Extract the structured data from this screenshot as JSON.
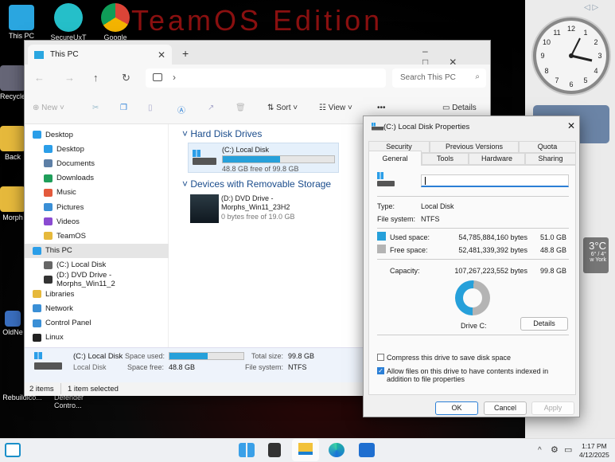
{
  "desktop": {
    "watermark": "TeamOS Edition",
    "icons": [
      "This PC",
      "SecureUxT",
      "Google",
      "Recycle",
      "Back",
      "Morph",
      "OldNe",
      "Rebuildico...",
      "Defender Contro..."
    ]
  },
  "gadgets": {
    "weather": {
      "temp": "3°C",
      "range": "6° / 4°",
      "city": "w York"
    }
  },
  "explorer": {
    "tab_title": "This PC",
    "search_placeholder": "Search This PC",
    "toolbar": {
      "new": "New",
      "sort": "Sort",
      "view": "View",
      "more": "•••",
      "details": "Details"
    },
    "sidebar": [
      {
        "label": "Desktop",
        "c": "#2b9ee8"
      },
      {
        "label": "Desktop",
        "c": "#2b9ee8"
      },
      {
        "label": "Documents",
        "c": "#5d7fa6"
      },
      {
        "label": "Downloads",
        "c": "#1f9e5a"
      },
      {
        "label": "Music",
        "c": "#e35a3c"
      },
      {
        "label": "Pictures",
        "c": "#3a8fd6"
      },
      {
        "label": "Videos",
        "c": "#8a4bd1"
      },
      {
        "label": "TeamOS",
        "c": "#e6b93c"
      },
      {
        "label": "This PC",
        "c": "#2b9ee8"
      },
      {
        "label": "(C:) Local Disk",
        "c": "#666"
      },
      {
        "label": "(D:) DVD Drive - Morphs_Win11_2",
        "c": "#333"
      },
      {
        "label": "Libraries",
        "c": "#e6b93c"
      },
      {
        "label": "Network",
        "c": "#3a8fd6"
      },
      {
        "label": "Control Panel",
        "c": "#3a8fd6"
      },
      {
        "label": "Linux",
        "c": "#222"
      }
    ],
    "groups": {
      "hdd": "Hard Disk Drives",
      "removable": "Devices with Removable Storage"
    },
    "drives": {
      "c": {
        "name": "(C:) Local Disk",
        "free": "48.8 GB free of 99.8 GB",
        "used_fraction": 0.511
      },
      "d": {
        "name": "(D:) DVD Drive -",
        "name2": "Morphs_Win11_23H2",
        "free": "0 bytes free of 19.0 GB"
      }
    },
    "details_pane": {
      "name": "(C:) Local Disk",
      "type": "Local Disk",
      "space_used_label": "Space used:",
      "space_free_label": "Space free:",
      "space_free": "48.8 GB",
      "total_label": "Total size:",
      "total": "99.8 GB",
      "fs_label": "File system:",
      "fs": "NTFS"
    },
    "status": {
      "items": "2 items",
      "selected": "1 item selected"
    }
  },
  "dialog": {
    "title": "(C:) Local Disk Properties",
    "tabs_top": [
      "Security",
      "Previous Versions",
      "Quota"
    ],
    "tabs_bottom": [
      "General",
      "Tools",
      "Hardware",
      "Sharing"
    ],
    "name_value": "",
    "type_label": "Type:",
    "type": "Local Disk",
    "fs_label": "File system:",
    "fs": "NTFS",
    "used_label": "Used space:",
    "used_bytes": "54,785,884,160 bytes",
    "used_gb": "51.0 GB",
    "free_label": "Free space:",
    "free_bytes": "52,481,339,392 bytes",
    "free_gb": "48.8 GB",
    "cap_label": "Capacity:",
    "cap_bytes": "107,267,223,552 bytes",
    "cap_gb": "99.8 GB",
    "used_fraction": 0.511,
    "drive_label": "Drive C:",
    "details_btn": "Details",
    "compress": "Compress this drive to save disk space",
    "compress_checked": false,
    "index": "Allow files on this drive to have contents indexed in addition to file properties",
    "index_checked": true,
    "ok": "OK",
    "cancel": "Cancel",
    "apply": "Apply",
    "colors": {
      "used": "#26a0da",
      "free": "#b4b4b4"
    }
  },
  "taskbar": {
    "time": "1:17 PM",
    "date": "4/12/2025"
  }
}
